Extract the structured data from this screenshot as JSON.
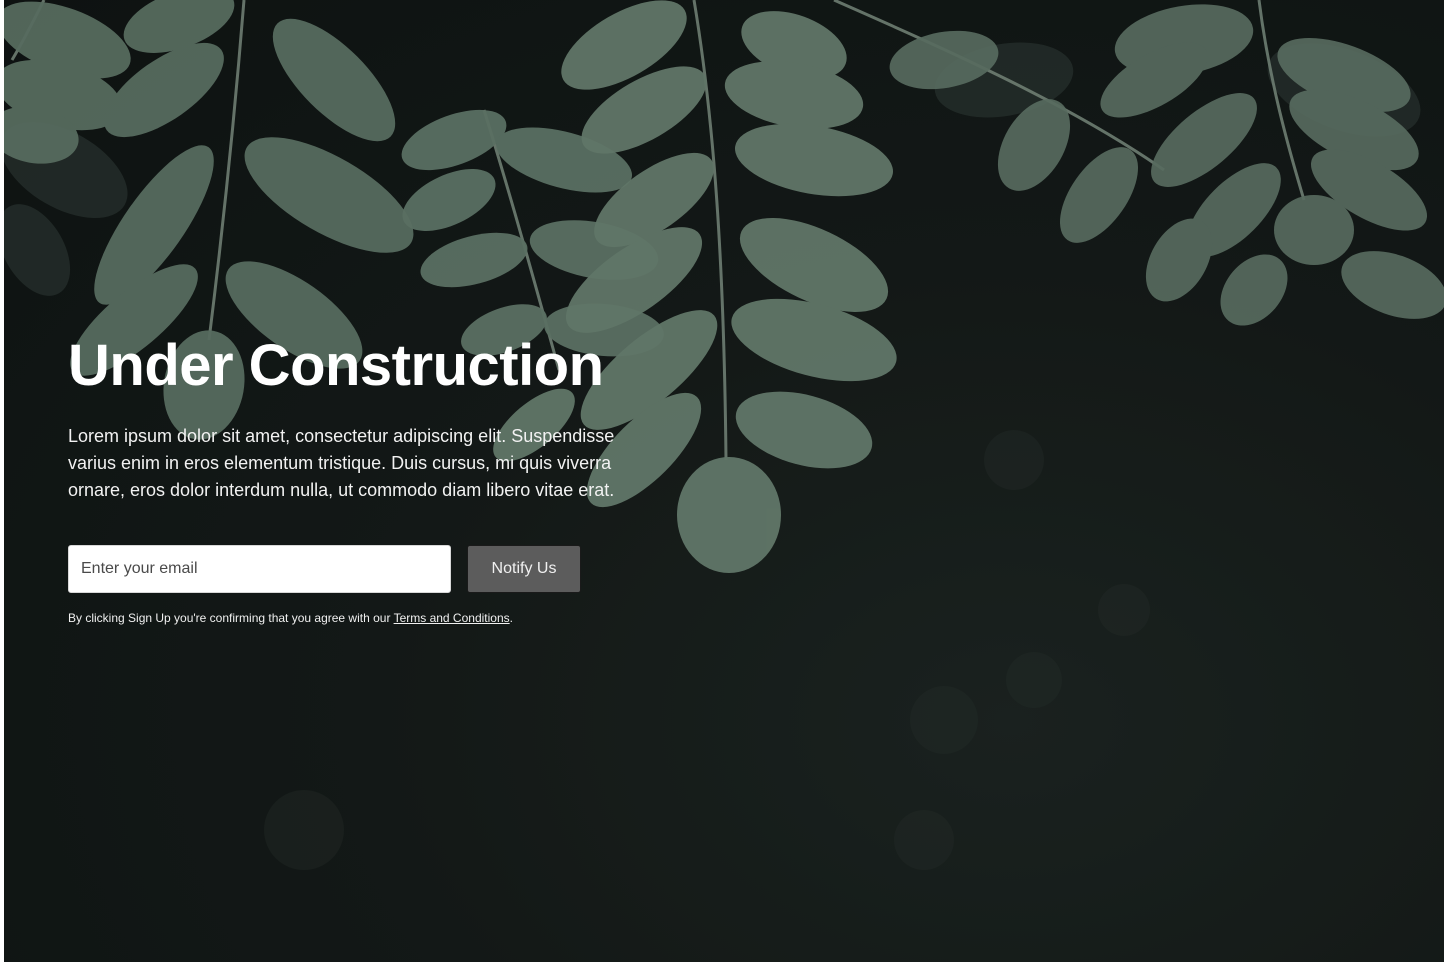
{
  "hero": {
    "title": "Under Construction",
    "description": "Lorem ipsum dolor sit amet, consectetur adipiscing elit. Suspendisse varius enim in eros elementum tristique. Duis cursus, mi quis viverra ornare, eros dolor interdum nulla, ut commodo diam libero vitae erat."
  },
  "form": {
    "email_placeholder": "Enter your email",
    "email_value": "",
    "button_label": "Notify Us"
  },
  "terms": {
    "prefix": "By clicking Sign Up you're confirming that you agree with our ",
    "link_label": "Terms and Conditions",
    "suffix": "."
  },
  "colors": {
    "background": "#141917",
    "leaf": "#62786a",
    "button": "#5c5c5c",
    "text": "#ffffff"
  },
  "background_image": "leaves-photo"
}
